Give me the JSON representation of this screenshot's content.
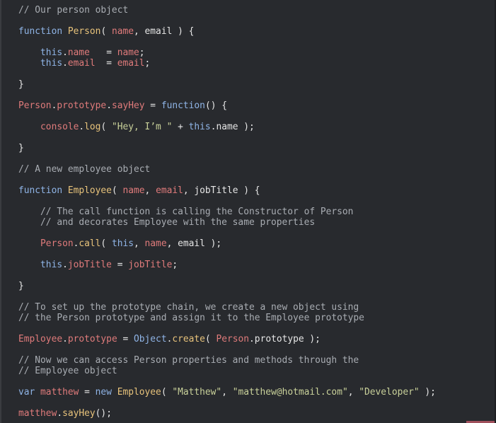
{
  "editor": {
    "theme_colors": {
      "background": "#282a2e",
      "comment": "#a9adb3",
      "keyword": "#8fb4e6",
      "function_name": "#e8c37b",
      "property": "#e07b7b",
      "string": "#c9d19a",
      "text": "#e6e6e6"
    },
    "lines": [
      [
        {
          "c": "cm",
          "t": "// Our person object"
        }
      ],
      [],
      [
        {
          "c": "kw",
          "t": "function "
        },
        {
          "c": "fn",
          "t": "Person"
        },
        {
          "c": "tx",
          "t": "( "
        },
        {
          "c": "pr",
          "t": "name"
        },
        {
          "c": "tx",
          "t": ", email ) {"
        }
      ],
      [],
      [
        {
          "c": "kw",
          "t": "    this"
        },
        {
          "c": "tx",
          "t": "."
        },
        {
          "c": "pr",
          "t": "name"
        },
        {
          "c": "tx",
          "t": "   = "
        },
        {
          "c": "pr",
          "t": "name"
        },
        {
          "c": "tx",
          "t": ";"
        }
      ],
      [
        {
          "c": "kw",
          "t": "    this"
        },
        {
          "c": "tx",
          "t": "."
        },
        {
          "c": "pr",
          "t": "email"
        },
        {
          "c": "tx",
          "t": "  = "
        },
        {
          "c": "pr",
          "t": "email"
        },
        {
          "c": "tx",
          "t": ";"
        }
      ],
      [],
      [
        {
          "c": "tx",
          "t": "}"
        }
      ],
      [],
      [
        {
          "c": "pr",
          "t": "Person"
        },
        {
          "c": "tx",
          "t": "."
        },
        {
          "c": "pr",
          "t": "prototype"
        },
        {
          "c": "tx",
          "t": "."
        },
        {
          "c": "pr",
          "t": "sayHey"
        },
        {
          "c": "tx",
          "t": " = "
        },
        {
          "c": "kw",
          "t": "function"
        },
        {
          "c": "tx",
          "t": "() {"
        }
      ],
      [],
      [
        {
          "c": "pr",
          "t": "    console"
        },
        {
          "c": "tx",
          "t": "."
        },
        {
          "c": "fn",
          "t": "log"
        },
        {
          "c": "tx",
          "t": "( "
        },
        {
          "c": "str",
          "t": "\"Hey, I’m \""
        },
        {
          "c": "tx",
          "t": " + "
        },
        {
          "c": "kw",
          "t": "this"
        },
        {
          "c": "tx",
          "t": ".name );"
        }
      ],
      [],
      [
        {
          "c": "tx",
          "t": "}"
        }
      ],
      [],
      [
        {
          "c": "cm",
          "t": "// A new employee object"
        }
      ],
      [],
      [
        {
          "c": "kw",
          "t": "function "
        },
        {
          "c": "fn",
          "t": "Employee"
        },
        {
          "c": "tx",
          "t": "( "
        },
        {
          "c": "pr",
          "t": "name"
        },
        {
          "c": "tx",
          "t": ", "
        },
        {
          "c": "pr",
          "t": "email"
        },
        {
          "c": "tx",
          "t": ", jobTitle ) {"
        }
      ],
      [],
      [
        {
          "c": "cm",
          "t": "    // The call function is calling the Constructor of Person"
        }
      ],
      [
        {
          "c": "cm",
          "t": "    // and decorates Employee with the same properties"
        }
      ],
      [],
      [
        {
          "c": "pr",
          "t": "    Person"
        },
        {
          "c": "tx",
          "t": "."
        },
        {
          "c": "fn",
          "t": "call"
        },
        {
          "c": "tx",
          "t": "( "
        },
        {
          "c": "kw",
          "t": "this"
        },
        {
          "c": "tx",
          "t": ", "
        },
        {
          "c": "pr",
          "t": "name"
        },
        {
          "c": "tx",
          "t": ", email );"
        }
      ],
      [],
      [
        {
          "c": "kw",
          "t": "    this"
        },
        {
          "c": "tx",
          "t": "."
        },
        {
          "c": "pr",
          "t": "jobTitle"
        },
        {
          "c": "tx",
          "t": " = "
        },
        {
          "c": "pr",
          "t": "jobTitle"
        },
        {
          "c": "tx",
          "t": ";"
        }
      ],
      [],
      [
        {
          "c": "tx",
          "t": "}"
        }
      ],
      [],
      [
        {
          "c": "cm",
          "t": "// To set up the prototype chain, we create a new object using"
        }
      ],
      [
        {
          "c": "cm",
          "t": "// the Person prototype and assign it to the Employee prototype"
        }
      ],
      [],
      [
        {
          "c": "pr",
          "t": "Employee"
        },
        {
          "c": "tx",
          "t": "."
        },
        {
          "c": "pr",
          "t": "prototype"
        },
        {
          "c": "tx",
          "t": " = "
        },
        {
          "c": "kw",
          "t": "Object"
        },
        {
          "c": "tx",
          "t": "."
        },
        {
          "c": "fn",
          "t": "create"
        },
        {
          "c": "tx",
          "t": "( "
        },
        {
          "c": "pr",
          "t": "Person"
        },
        {
          "c": "tx",
          "t": ".prototype );"
        }
      ],
      [],
      [
        {
          "c": "cm",
          "t": "// Now we can access Person properties and methods through the"
        }
      ],
      [
        {
          "c": "cm",
          "t": "// Employee object"
        }
      ],
      [],
      [
        {
          "c": "kw",
          "t": "var "
        },
        {
          "c": "pr",
          "t": "matthew"
        },
        {
          "c": "tx",
          "t": " = "
        },
        {
          "c": "kw",
          "t": "new "
        },
        {
          "c": "fn",
          "t": "Employee"
        },
        {
          "c": "tx",
          "t": "( "
        },
        {
          "c": "str",
          "t": "\"Matthew\""
        },
        {
          "c": "tx",
          "t": ", "
        },
        {
          "c": "str",
          "t": "\"matthew@hotmail.com\""
        },
        {
          "c": "tx",
          "t": ", "
        },
        {
          "c": "str",
          "t": "\"Developer\""
        },
        {
          "c": "tx",
          "t": " );"
        }
      ],
      [],
      [
        {
          "c": "pr",
          "t": "matthew"
        },
        {
          "c": "tx",
          "t": "."
        },
        {
          "c": "fn",
          "t": "sayHey"
        },
        {
          "c": "tx",
          "t": "();"
        }
      ]
    ]
  }
}
